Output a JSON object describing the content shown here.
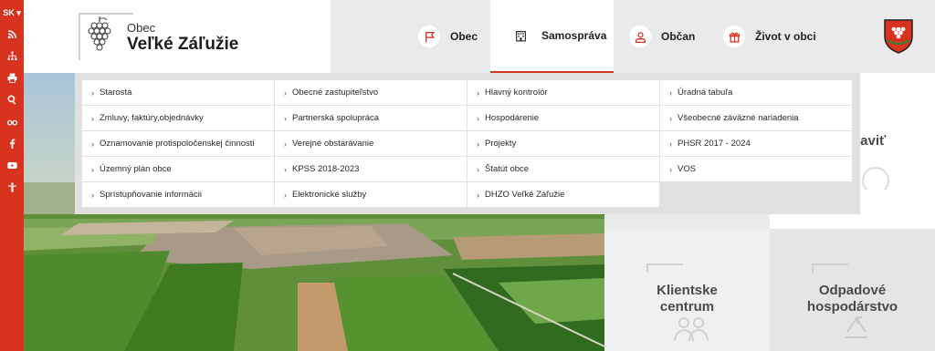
{
  "sidebar": {
    "lang": "SK",
    "icons": [
      "rss-icon",
      "sitemap-icon",
      "print-icon",
      "search-icon",
      "glasses-icon",
      "facebook-icon",
      "youtube-icon",
      "accessibility-icon"
    ]
  },
  "logo": {
    "obec": "Obec",
    "title": "Veľké Záľužie"
  },
  "nav": [
    {
      "label": "Obec",
      "icon": "flag-icon"
    },
    {
      "label": "Samospráva",
      "icon": "building-icon"
    },
    {
      "label": "Občan",
      "icon": "person-icon"
    },
    {
      "label": "Život v obci",
      "icon": "gift-icon"
    }
  ],
  "menu": {
    "columns": [
      [
        "Starosta",
        "Zmluvy, faktúry,objednávky",
        "Oznamovanie protispoločenskej činnosti",
        "Územný plán obce",
        "Sprístupňovanie informácii"
      ],
      [
        "Obecné zastupiteľstvo",
        "Partnerská spolupráca",
        "Verejné obstarávanie",
        "KPSS 2018-2023",
        "Elektronické služby"
      ],
      [
        "Hlavný kontrolór",
        "Hospodárenie",
        "Projekty",
        "Štatút obce",
        "DHZO Veľké Záľužie"
      ],
      [
        "Úradná tabuľa",
        "Všeobecné záväzné nariadenia",
        "PHSR 2017 - 2024",
        "VOS"
      ]
    ]
  },
  "tiles": {
    "partial": "baviť",
    "klientske_1": "Klientske",
    "klientske_2": "centrum",
    "odpad_1": "Odpadové",
    "odpad_2": "hospodárstvo"
  },
  "colors": {
    "accent": "#d8331f",
    "nav_bg": "#e9eaec"
  }
}
